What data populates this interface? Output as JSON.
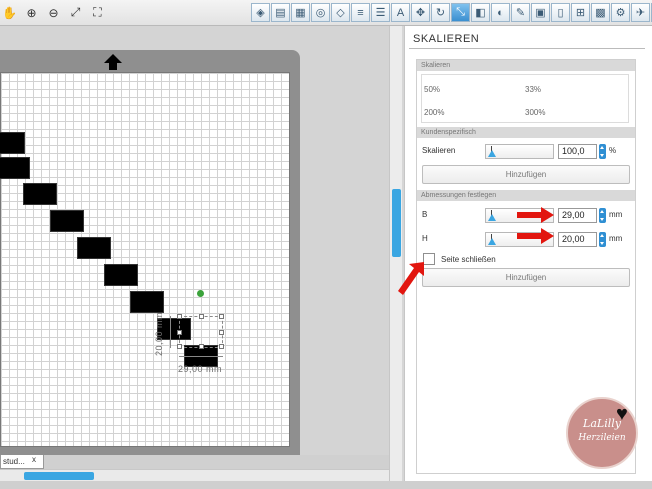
{
  "toolbar": {
    "left_tools": [
      {
        "icon": "hand-icon",
        "glyph": "✋"
      },
      {
        "icon": "zoom-in-icon",
        "glyph": "⊕"
      },
      {
        "icon": "zoom-out-icon",
        "glyph": "⊖"
      },
      {
        "icon": "zoom-select-icon",
        "glyph": "⤢"
      },
      {
        "icon": "fit-to-window-icon",
        "glyph": "⛶"
      }
    ],
    "right_tools": [
      {
        "icon": "fill-icon",
        "glyph": "◈"
      },
      {
        "icon": "line-style-icon",
        "glyph": "▤"
      },
      {
        "icon": "grid-icon",
        "glyph": "▦"
      },
      {
        "icon": "replicate-icon",
        "glyph": "◎"
      },
      {
        "icon": "transform-icon",
        "glyph": "◇"
      },
      {
        "icon": "align-icon",
        "glyph": "≡"
      },
      {
        "icon": "text-style-icon",
        "glyph": "☰"
      },
      {
        "icon": "text-icon",
        "glyph": "A"
      },
      {
        "icon": "move-icon",
        "glyph": "✥"
      },
      {
        "icon": "rotate-icon",
        "glyph": "↻"
      },
      {
        "icon": "scale-icon",
        "glyph": "⤡",
        "active": true
      },
      {
        "icon": "mirror-icon",
        "glyph": "◧"
      },
      {
        "icon": "offset-icon",
        "glyph": "◐"
      },
      {
        "icon": "trace-icon",
        "glyph": "✎"
      },
      {
        "icon": "cut-settings-icon",
        "glyph": "▣"
      },
      {
        "icon": "page-setup-icon",
        "glyph": "▯"
      },
      {
        "icon": "registration-icon",
        "glyph": "⊞"
      },
      {
        "icon": "design-store-icon",
        "glyph": "▩"
      },
      {
        "icon": "library-icon",
        "glyph": "⚙"
      },
      {
        "icon": "send-icon",
        "glyph": "✈"
      },
      {
        "icon": "sketch-icon",
        "glyph": "✏"
      },
      {
        "icon": "eraser-icon",
        "glyph": "⌫"
      }
    ]
  },
  "document": {
    "tab_label": "stud...",
    "tab_close": "x"
  },
  "selection": {
    "width_text": "29,00 mm",
    "height_text": "20,00 mm"
  },
  "panel": {
    "title": "SKALIEREN",
    "scale_section": {
      "header": "Skalieren",
      "options": [
        "50%",
        "33%",
        "200%",
        "300%"
      ]
    },
    "custom_section": {
      "header": "Kundenspezifisch",
      "label": "Skalieren",
      "value": "100,0",
      "unit": "%",
      "button": "Hinzufügen"
    },
    "dimensions_section": {
      "header": "Abmessungen festlegen",
      "width_label": "B",
      "width_value": "29,00",
      "height_label": "H",
      "height_value": "20,00",
      "unit": "mm",
      "lock_label": "Seite schließen",
      "lock_checked": false,
      "button": "Hinzufügen"
    }
  },
  "watermark": {
    "line1": "LaLilly",
    "line2": "Herzileien",
    "color": "#c98f8b"
  },
  "colors": {
    "accent": "#3aa6e2",
    "annotation_arrow": "#e2160f"
  }
}
